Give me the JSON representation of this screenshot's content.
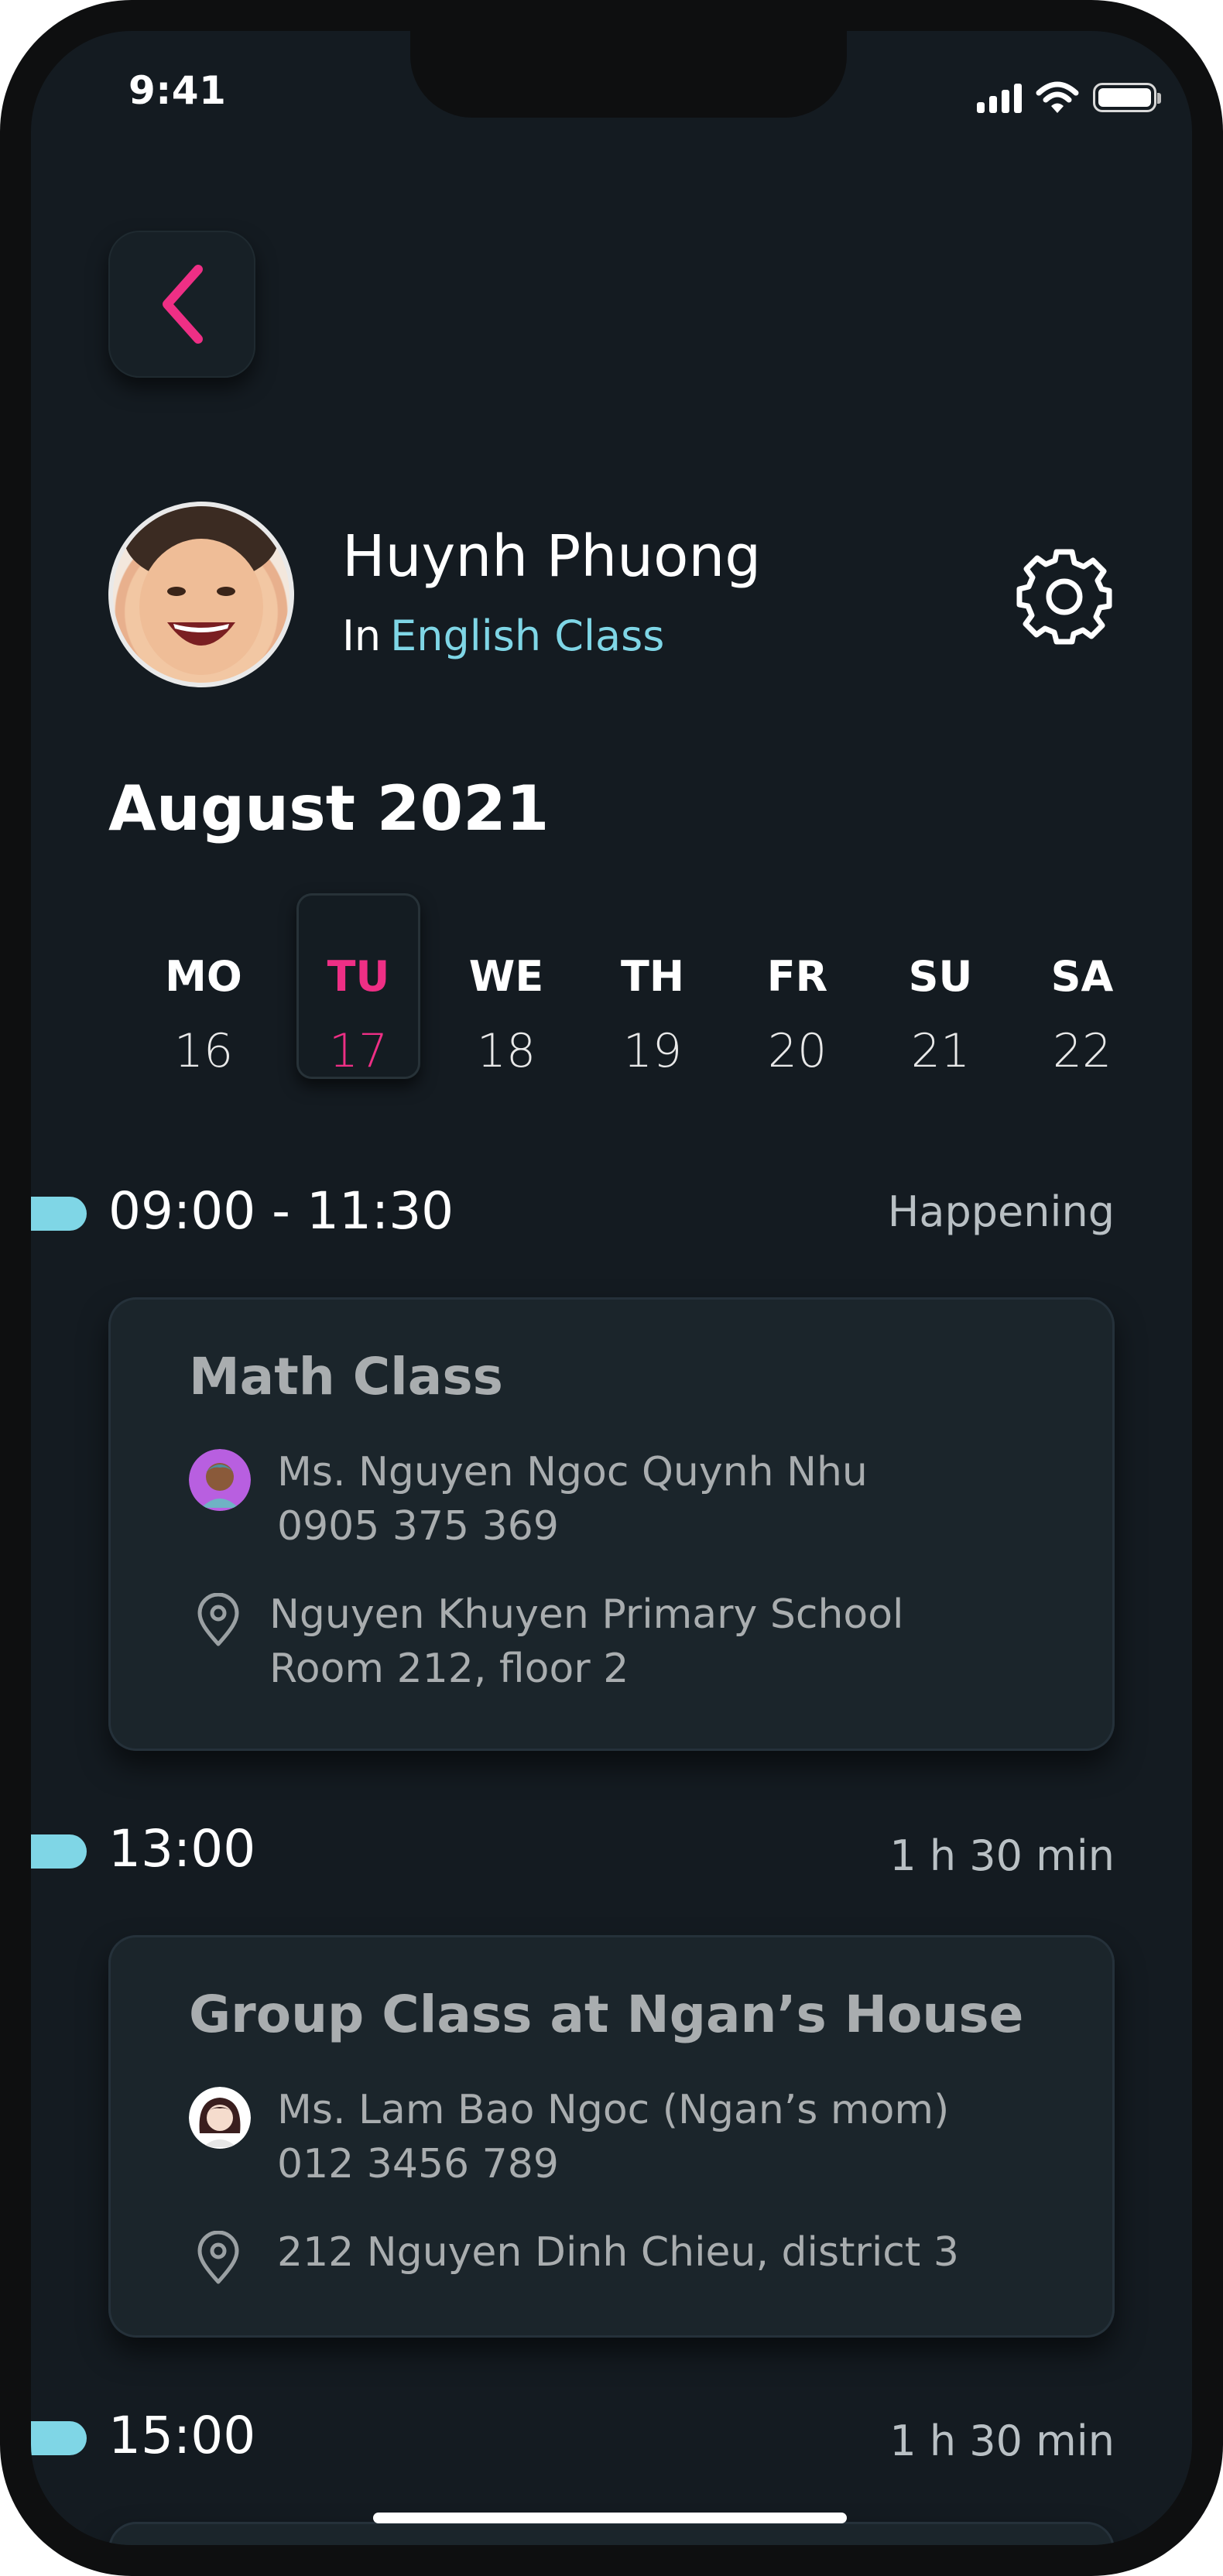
{
  "status_bar": {
    "time": "9:41"
  },
  "profile": {
    "name": "Huynh Phuong",
    "class_prefix": "In",
    "class_name": "English Class"
  },
  "calendar": {
    "month_label": "August  2021",
    "days": [
      {
        "name": "MO",
        "date": "16",
        "active": false
      },
      {
        "name": "TU",
        "date": "17",
        "active": true
      },
      {
        "name": "WE",
        "date": "18",
        "active": false
      },
      {
        "name": "TH",
        "date": "19",
        "active": false
      },
      {
        "name": "FR",
        "date": "20",
        "active": false
      },
      {
        "name": "SU",
        "date": "21",
        "active": false
      },
      {
        "name": "SA",
        "date": "22",
        "active": false
      }
    ]
  },
  "schedule": [
    {
      "time": "09:00 - 11:30",
      "meta": "Happening",
      "title": "Math Class",
      "teacher": "Ms. Nguyen Ngoc Quynh Nhu",
      "phone": "0905 375 369",
      "location_line1": "Nguyen Khuyen Primary School",
      "location_line2": "Room 212, floor 2"
    },
    {
      "time": "13:00",
      "meta": "1 h 30 min",
      "title": "Group Class at Ngan’s House",
      "teacher": "Ms. Lam Bao Ngoc (Ngan’s mom)",
      "phone": "012 3456 789",
      "location_line1": "212 Nguyen Dinh Chieu, district 3"
    },
    {
      "time": "15:00",
      "meta": "1 h 30 min"
    }
  ],
  "colors": {
    "accent_pink": "#ee2f85",
    "accent_cyan": "#7fd6e6",
    "background": "#141b21"
  },
  "icons": [
    "back-chevron-icon",
    "gear-icon",
    "location-pin-icon",
    "signal-icon",
    "wifi-icon",
    "battery-icon"
  ]
}
